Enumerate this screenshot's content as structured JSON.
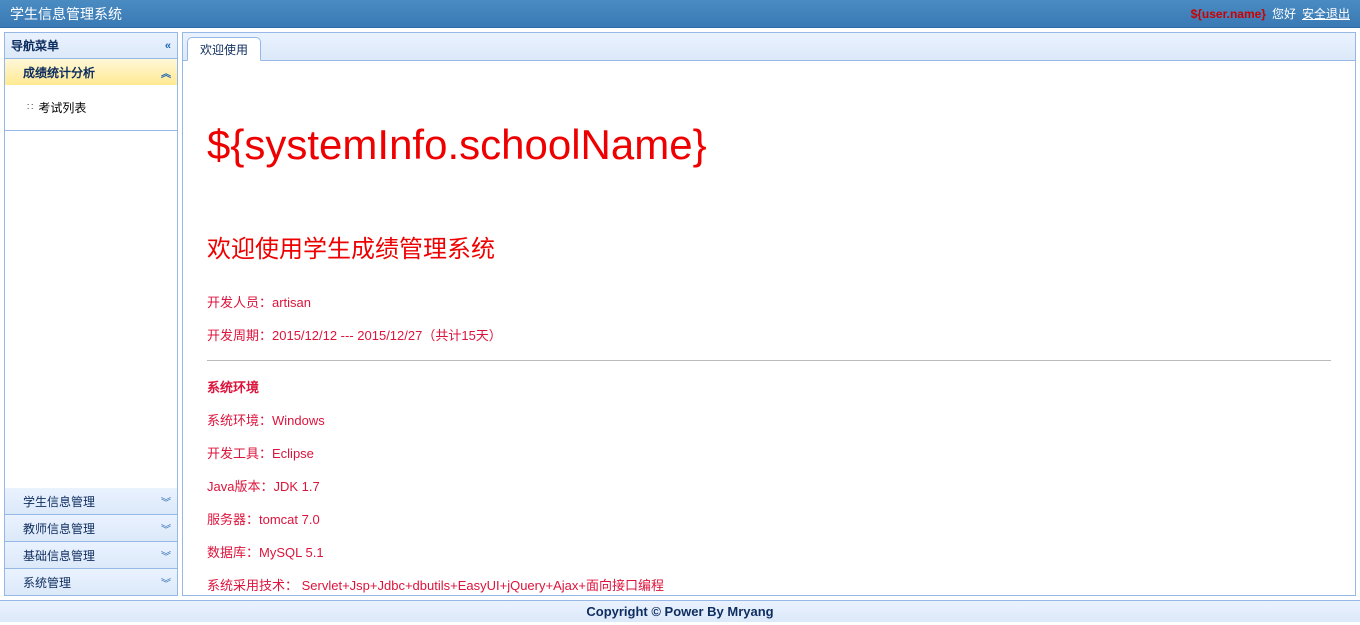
{
  "header": {
    "app_title": "学生信息管理系统",
    "user_name": "${user.name}",
    "greeting": "您好",
    "logout": "安全退出"
  },
  "sidebar": {
    "title": "导航菜单",
    "panels": [
      {
        "label": "成绩统计分析",
        "expanded": true,
        "items": [
          {
            "label": "考试列表"
          }
        ]
      },
      {
        "label": "学生信息管理",
        "expanded": false
      },
      {
        "label": "教师信息管理",
        "expanded": false
      },
      {
        "label": "基础信息管理",
        "expanded": false
      },
      {
        "label": "系统管理",
        "expanded": false
      }
    ]
  },
  "tabs": [
    {
      "label": "欢迎使用",
      "active": true
    }
  ],
  "content": {
    "school_name": "${systemInfo.schoolName}",
    "welcome_heading": "欢迎使用学生成绩管理系统",
    "developer_line": "开发人员：artisan",
    "period_line": "开发周期：2015/12/12 --- 2015/12/27（共计15天）",
    "env_heading": "系统环境",
    "env_os": "系统环境：Windows",
    "env_ide": "开发工具：Eclipse",
    "env_java": "Java版本：JDK 1.7",
    "env_server": "服务器：tomcat 7.0",
    "env_db": "数据库：MySQL 5.1",
    "env_tech": "系统采用技术： Servlet+Jsp+Jdbc+dbutils+EasyUI+jQuery+Ajax+面向接口编程"
  },
  "footer": {
    "copyright": "Copyright © Power By Mryang"
  }
}
